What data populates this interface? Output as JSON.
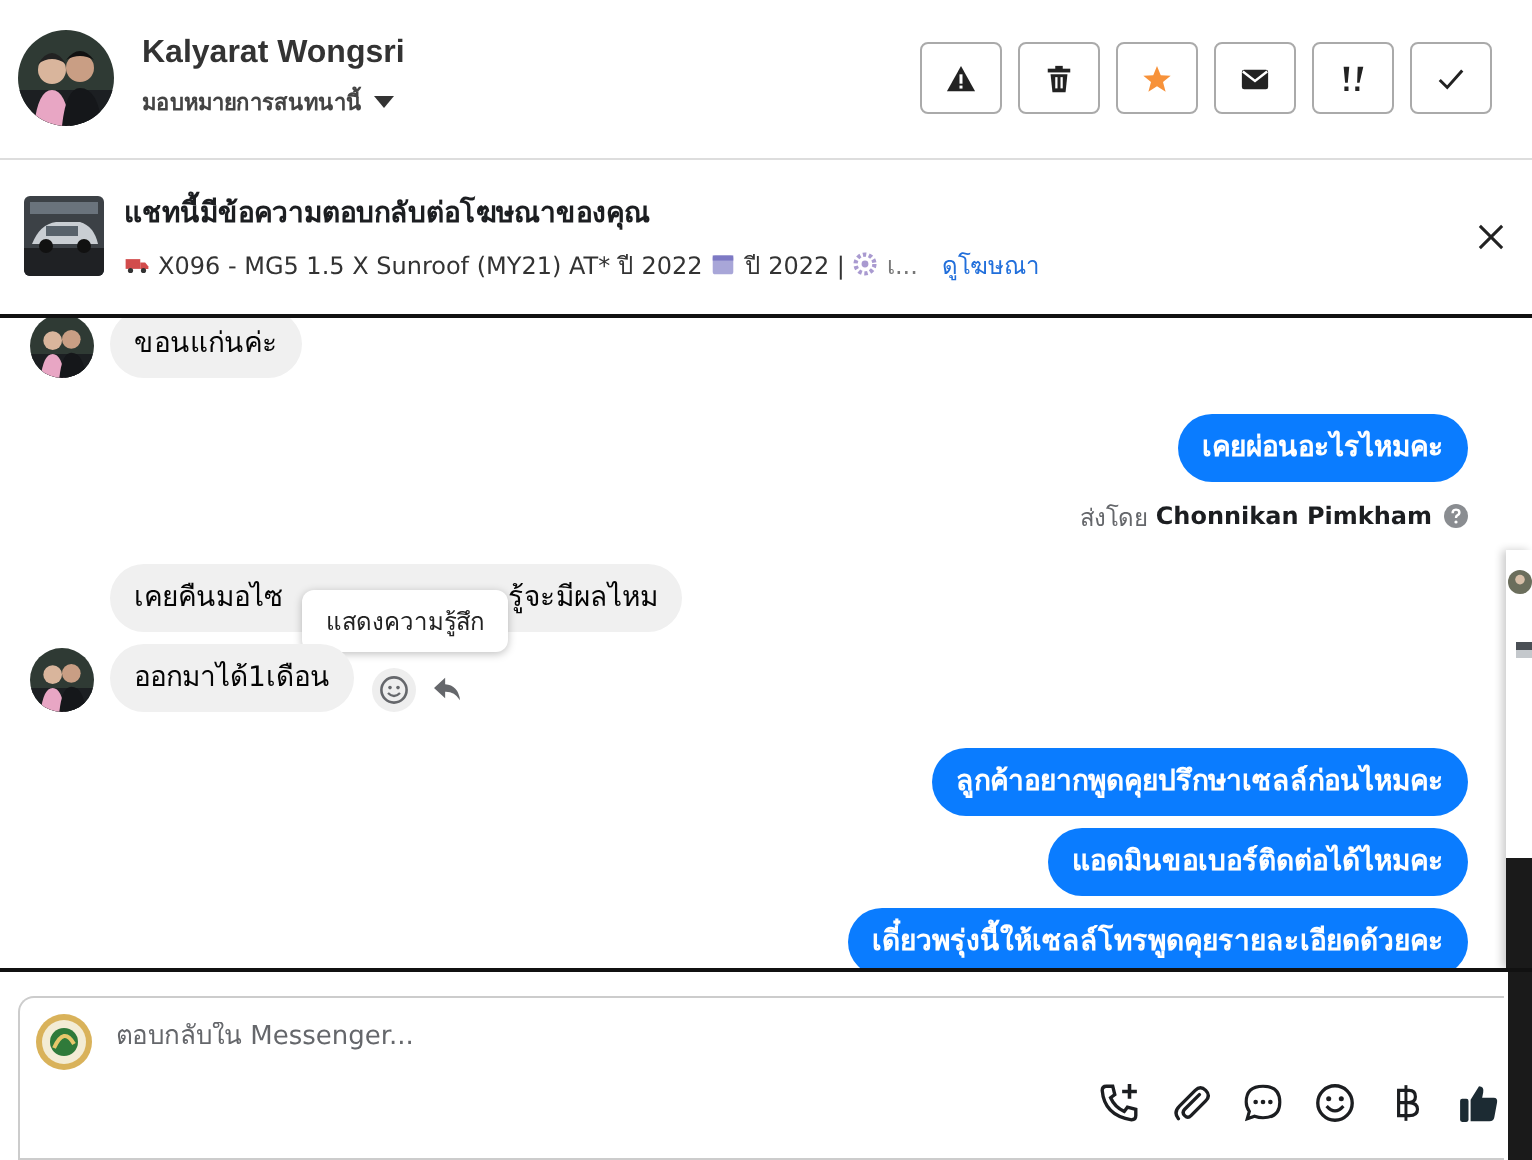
{
  "header": {
    "name": "Kalyarat Wongsri",
    "assign_label": "มอบหมายการสนทนานี้",
    "actions": [
      {
        "kind": "warning"
      },
      {
        "kind": "trash"
      },
      {
        "kind": "star"
      },
      {
        "kind": "mail"
      },
      {
        "kind": "important"
      },
      {
        "kind": "done"
      }
    ]
  },
  "ad_banner": {
    "title": "แชทนี้มีข้อความตอบกลับต่อโฆษณาของคุณ",
    "details": "X096 - MG5 1.5 X Sunroof (MY21) AT* ปี 2022",
    "year": "ปี 2022 |",
    "more": "เ...",
    "link": "ดูโฆษณา"
  },
  "messages": [
    {
      "kind": "incoming",
      "avatar": true,
      "parts": [
        "ขอนแก่นค่ะ"
      ]
    },
    {
      "kind": "outgoing",
      "parts": [
        "เคยผ่อนอะไรไหมคะ"
      ],
      "sent_by_label": "ส่งโดย",
      "sent_by": "Chonnikan Pimkham"
    },
    {
      "kind": "incoming",
      "avatar": false,
      "parts": [
        "เคยคืนมอไซ",
        "รู้จะมีผลไหม"
      ],
      "tooltip": "แสดงความรู้สึก"
    },
    {
      "kind": "incoming",
      "avatar": true,
      "parts": [
        "ออกมาได้1เดือน"
      ],
      "hover_actions": true
    },
    {
      "kind": "outgoing",
      "parts": [
        "ลูกค้าอยากพูดคุยปรึกษาเซลล์ก่อนไหมคะ"
      ]
    },
    {
      "kind": "outgoing",
      "parts": [
        "แอดมินขอเบอร์ติดต่อได้ไหมคะ"
      ]
    },
    {
      "kind": "outgoing",
      "parts": [
        "เดี๋ยวพรุ่งนี้ให้เซลล์โทรพูดคุยรายละเอียดด้วยคะ"
      ]
    }
  ],
  "composer": {
    "placeholder": "ตอบกลับใน Messenger...",
    "tools": [
      {
        "kind": "call"
      },
      {
        "kind": "attach"
      },
      {
        "kind": "saved"
      },
      {
        "kind": "emoji"
      },
      {
        "kind": "baht"
      },
      {
        "kind": "like"
      }
    ]
  }
}
